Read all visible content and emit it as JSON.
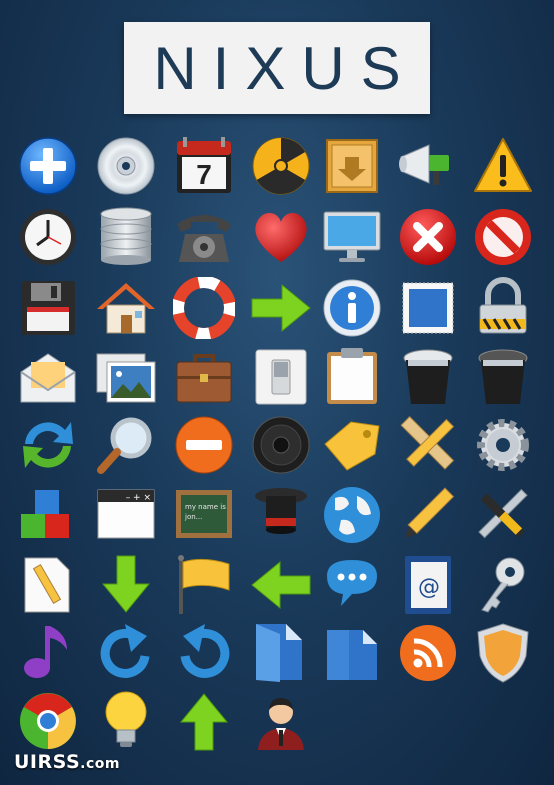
{
  "title": "NIXUS",
  "watermark": {
    "brand": "UIRSS",
    "suffix": ".com"
  },
  "icons": [
    "add-icon",
    "cd-icon",
    "calendar-icon",
    "radiation-icon",
    "box-icon",
    "megaphone-icon",
    "warning-icon",
    "clock-icon",
    "database-icon",
    "telephone-icon",
    "heart-icon",
    "monitor-icon",
    "error-icon",
    "forbidden-icon",
    "floppy-icon",
    "home-icon",
    "lifebuoy-icon",
    "arrow-right-icon",
    "info-icon",
    "picture-frame-icon",
    "lock-icon",
    "mail-icon",
    "photos-icon",
    "briefcase-icon",
    "switch-icon",
    "clipboard-icon",
    "trash-full-icon",
    "trash-empty-icon",
    "refresh-icon",
    "magnifier-icon",
    "remove-icon",
    "speaker-icon",
    "tag-icon",
    "design-tools-icon",
    "settings-gear-icon",
    "blocks-icon",
    "window-icon",
    "chalkboard-icon",
    "magic-hat-icon",
    "globe-icon",
    "pencil-icon",
    "tools-icon",
    "document-edit-icon",
    "arrow-down-icon",
    "flag-icon",
    "arrow-left-icon",
    "chat-icon",
    "address-book-icon",
    "key-icon",
    "music-note-icon",
    "redo-icon",
    "undo-icon",
    "folder-icon",
    "file-icon",
    "rss-icon",
    "shield-icon",
    "chrome-icon",
    "lightbulb-icon",
    "arrow-up-icon",
    "user-icon"
  ],
  "calendar": {
    "day": "7"
  },
  "chalkboard": {
    "line1": "my name is",
    "line2": "jon..."
  },
  "window": {
    "controls": "– + ×"
  },
  "address_book": {
    "symbol": "@"
  }
}
